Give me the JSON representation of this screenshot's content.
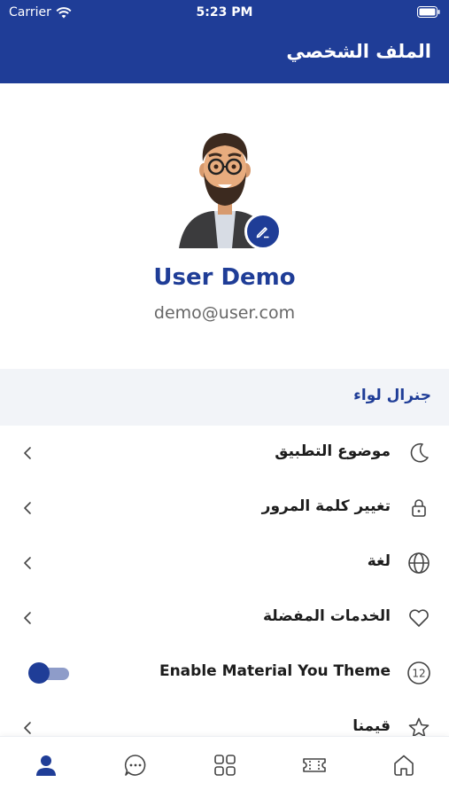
{
  "status_bar": {
    "carrier": "Carrier",
    "time": "5:23 PM"
  },
  "app_bar": {
    "title": "الملف الشخصي"
  },
  "profile": {
    "name": "User Demo",
    "email": "demo@user.com"
  },
  "section": {
    "title": "جنرال لواء"
  },
  "settings": {
    "items": [
      {
        "label": "موضوع التطبيق",
        "icon": "moon-icon"
      },
      {
        "label": "تغيير كلمة المرور",
        "icon": "lock-icon"
      },
      {
        "label": "لغة",
        "icon": "globe-icon"
      },
      {
        "label": "الخدمات المفضلة",
        "icon": "heart-icon"
      },
      {
        "label": "Enable Material You Theme",
        "icon": "number-12-icon",
        "toggle_on": true,
        "badge": "12"
      },
      {
        "label": "قيمنا",
        "icon": "star-icon"
      }
    ]
  },
  "tab_bar": {
    "tabs": [
      {
        "icon": "profile-icon",
        "active": true
      },
      {
        "icon": "chat-icon",
        "active": false
      },
      {
        "icon": "grid-icon",
        "active": false
      },
      {
        "icon": "ticket-icon",
        "active": false
      },
      {
        "icon": "home-icon",
        "active": false
      }
    ]
  },
  "colors": {
    "primary": "#1f3d97",
    "section_bg": "#f2f4f8",
    "text": "#1c1c1c",
    "muted": "#666666"
  }
}
